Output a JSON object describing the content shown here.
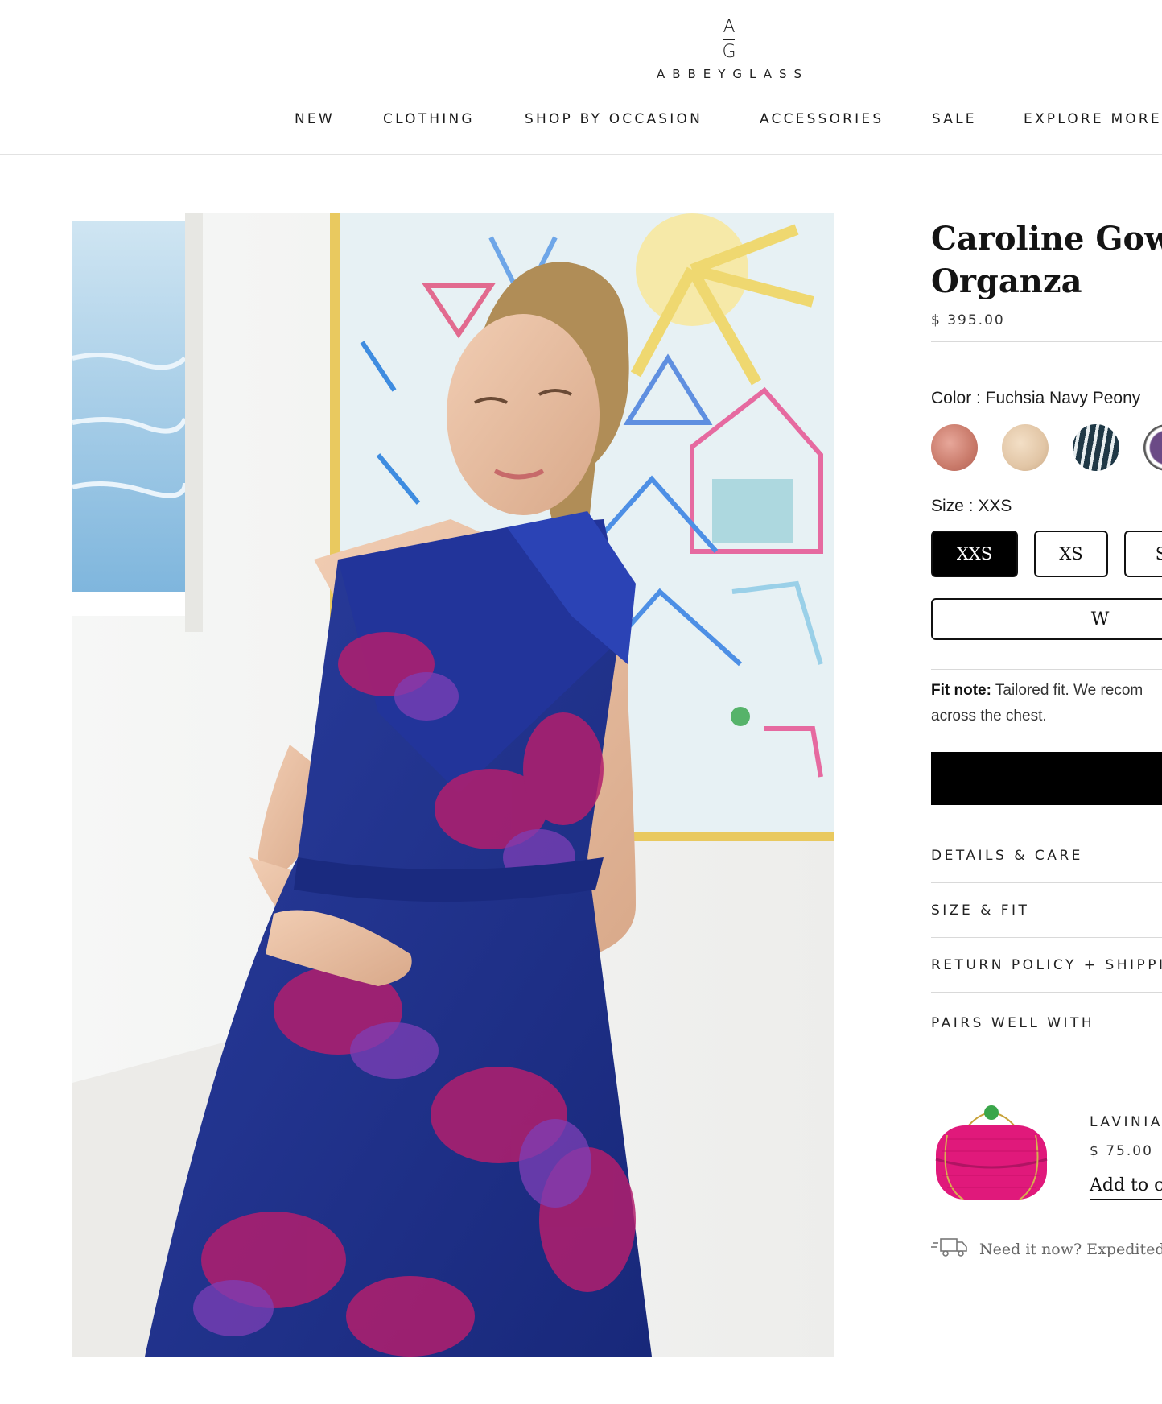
{
  "brand": {
    "mark_top": "A",
    "mark_bottom": "G",
    "wordmark": "ABBEYGLASS"
  },
  "nav": {
    "items": [
      "NEW",
      "CLOTHING",
      "SHOP BY OCCASION",
      "ACCESSORIES",
      "SALE",
      "EXPLORE MORE"
    ]
  },
  "product": {
    "title": "Caroline Gown Fuchsia Navy Organza",
    "title_visible": "Caroline Gown I Organza",
    "price": "$ 395.00",
    "color_label": "Color : Fuchsia Navy Peony",
    "size_label": "Size : XXS",
    "sizes": [
      "XXS",
      "XS",
      "S"
    ],
    "selected_size": "XXS",
    "waitlist_label": "W",
    "fit_note_label": "Fit note:",
    "fit_note_text": "Tailored fit. We recom across the chest.",
    "fit_note_line1": " Tailored fit. We recom",
    "fit_note_line2": "across the chest.",
    "swatch_colors": [
      "#c97a6a",
      "#e2c6a6",
      "#2f4a57",
      "#6b4a86"
    ]
  },
  "accordion": {
    "details": "DETAILS & CARE",
    "size_fit": "SIZE & FIT",
    "returns": "RETURN POLICY + SHIPPIN",
    "pairs": "PAIRS WELL WITH"
  },
  "pairs_item": {
    "name": "LAVINIA",
    "price": "$ 75.00",
    "add_label": "Add to ca"
  },
  "shipping_note": "Need it now? Expedited",
  "colors": {
    "accent": "#000000",
    "divider": "#d9d9d9",
    "dress_navy": "#1e2f86",
    "dress_fuchsia": "#b21f6d"
  }
}
